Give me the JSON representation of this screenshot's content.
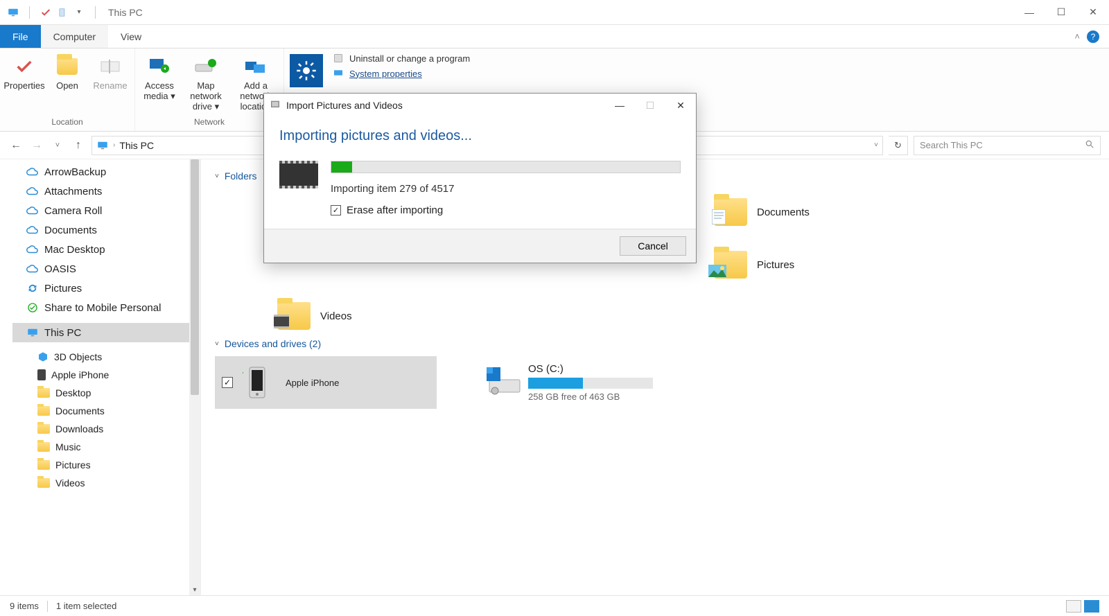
{
  "window": {
    "title": "This PC"
  },
  "tabs": {
    "file": "File",
    "computer": "Computer",
    "view": "View"
  },
  "ribbon": {
    "properties": "Properties",
    "open": "Open",
    "rename": "Rename",
    "access_media": "Access media",
    "map_drive": "Map network drive",
    "add_location": "Add a network location",
    "group_location": "Location",
    "group_network": "Network",
    "uninstall": "Uninstall or change a program",
    "system_props": "System properties"
  },
  "nav": {
    "breadcrumb": "This PC",
    "search_placeholder": "Search This PC"
  },
  "tree": {
    "items": [
      {
        "label": "ArrowBackup",
        "icon": "cloud"
      },
      {
        "label": "Attachments",
        "icon": "cloud"
      },
      {
        "label": "Camera Roll",
        "icon": "cloud"
      },
      {
        "label": "Documents",
        "icon": "cloud"
      },
      {
        "label": "Mac Desktop",
        "icon": "cloud"
      },
      {
        "label": "OASIS",
        "icon": "cloud"
      },
      {
        "label": "Pictures",
        "icon": "sync"
      },
      {
        "label": "Share to Mobile Personal",
        "icon": "check"
      }
    ],
    "thispc": "This PC",
    "sub": [
      {
        "label": "3D Objects"
      },
      {
        "label": "Apple iPhone"
      },
      {
        "label": "Desktop"
      },
      {
        "label": "Documents"
      },
      {
        "label": "Downloads"
      },
      {
        "label": "Music"
      },
      {
        "label": "Pictures"
      },
      {
        "label": "Videos"
      }
    ]
  },
  "content": {
    "folders_hdr": "Folders",
    "devices_hdr": "Devices and drives (2)",
    "folders": [
      {
        "label": "Videos"
      },
      {
        "label": "Documents"
      },
      {
        "label": "Pictures"
      }
    ],
    "iphone": "Apple iPhone",
    "os_drive": {
      "label": "OS (C:)",
      "free": "258 GB free of 463 GB",
      "fill_pct": 44
    }
  },
  "status": {
    "count": "9 items",
    "selected": "1 item selected"
  },
  "dialog": {
    "title": "Import Pictures and Videos",
    "heading": "Importing pictures and videos...",
    "current": 279,
    "total": 4517,
    "status_prefix": "Importing item",
    "status_mid": "of",
    "progress_pct": 6,
    "erase_label": "Erase after importing",
    "erase_checked": true,
    "cancel": "Cancel"
  }
}
